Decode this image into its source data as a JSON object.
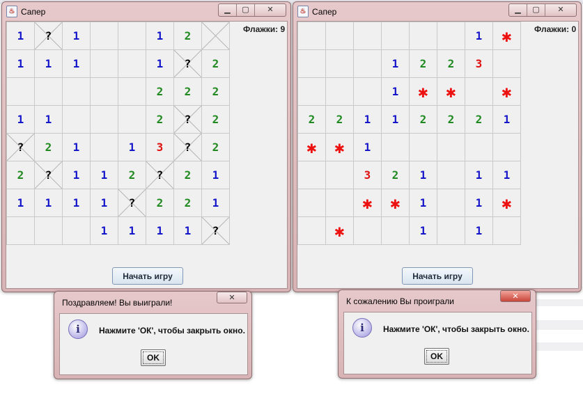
{
  "win_left": {
    "title": "Сапер",
    "flags_label": "Флажки: 9",
    "start_button": "Начать игру",
    "cells": [
      [
        "1",
        "?",
        "1",
        "",
        "",
        "1",
        "2",
        "X"
      ],
      [
        "1",
        "1",
        "1",
        "",
        "",
        "1",
        "?",
        "2"
      ],
      [
        "",
        "",
        "",
        "",
        "",
        "2",
        "2",
        "2"
      ],
      [
        "1",
        "1",
        "",
        "",
        "",
        "2",
        "?",
        "2"
      ],
      [
        "?",
        "2",
        "1",
        "",
        "1",
        "3",
        "?",
        "2"
      ],
      [
        "2",
        "?",
        "1",
        "1",
        "2",
        "?",
        "2",
        "1"
      ],
      [
        "1",
        "1",
        "1",
        "1",
        "?",
        "2",
        "2",
        "1"
      ],
      [
        "",
        "",
        "",
        "1",
        "1",
        "1",
        "1",
        "?"
      ]
    ]
  },
  "win_right": {
    "title": "Сапер",
    "flags_label": "Флажки: 0",
    "start_button": "Начать игру",
    "cells": [
      [
        "",
        "",
        "",
        "",
        "",
        "",
        "1",
        "*"
      ],
      [
        "",
        "",
        "",
        "1",
        "2",
        "2",
        "3",
        ""
      ],
      [
        "",
        "",
        "",
        "1",
        "*",
        "*",
        "",
        "*"
      ],
      [
        "2",
        "2",
        "1",
        "1",
        "2",
        "2",
        "2",
        "1"
      ],
      [
        "*",
        "*",
        "1",
        "",
        "",
        "",
        "",
        ""
      ],
      [
        "",
        "",
        "3",
        "2",
        "1",
        "",
        "1",
        "1"
      ],
      [
        "",
        "",
        "*",
        "*",
        "1",
        "",
        "1",
        "*"
      ],
      [
        "",
        "*",
        "",
        "",
        "1",
        "",
        "1",
        ""
      ]
    ]
  },
  "dialog_win": {
    "title": "Поздравляем! Вы выиграли!",
    "message": "Нажмите 'ОК', чтобы закрыть окно.",
    "ok_label": "OK"
  },
  "dialog_lose": {
    "title": "К сожалению Вы проиграли",
    "message": "Нажмите 'ОК', чтобы закрыть окно.",
    "ok_label": "OK"
  },
  "icons": {
    "minimize": "minimize-icon",
    "maximize": "maximize-icon",
    "close": "close-icon",
    "info": "info-icon",
    "mine": "mine-icon",
    "app": "java-app-icon"
  },
  "colors": {
    "one": "#1515c8",
    "two": "#1f8a1f",
    "three": "#e01010",
    "mine": "#ee1111",
    "window_frame": "#d8b3b5",
    "client": "#f0f0f0"
  }
}
